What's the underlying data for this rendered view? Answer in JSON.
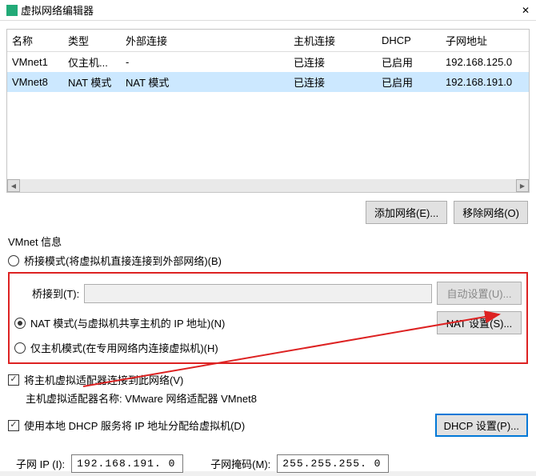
{
  "title": "虚拟网络编辑器",
  "table": {
    "headers": [
      "名称",
      "类型",
      "外部连接",
      "主机连接",
      "DHCP",
      "子网地址"
    ],
    "rows": [
      {
        "name": "VMnet1",
        "type": "仅主机...",
        "ext": "-",
        "host": "已连接",
        "dhcp": "已启用",
        "subnet": "192.168.125.0"
      },
      {
        "name": "VMnet8",
        "type": "NAT 模式",
        "ext": "NAT 模式",
        "host": "已连接",
        "dhcp": "已启用",
        "subnet": "192.168.191.0"
      }
    ]
  },
  "buttons": {
    "addNet": "添加网络(E)...",
    "removeNet": "移除网络(O)"
  },
  "groupLabel": "VMnet 信息",
  "radios": {
    "bridge": "桥接模式(将虚拟机直接连接到外部网络)(B)",
    "bridgeTo": "桥接到(T):",
    "autoSet": "自动设置(U)...",
    "nat": "NAT 模式(与虚拟机共享主机的 IP 地址)(N)",
    "natSet": "NAT 设置(S)...",
    "hostonly": "仅主机模式(在专用网络内连接虚拟机)(H)"
  },
  "checks": {
    "hostAdapter": "将主机虚拟适配器连接到此网络(V)",
    "adapterName": "主机虚拟适配器名称: VMware 网络适配器 VMnet8",
    "dhcp": "使用本地 DHCP 服务将 IP 地址分配给虚拟机(D)",
    "dhcpSet": "DHCP 设置(P)..."
  },
  "subnet": {
    "ipLabel": "子网 IP (I):",
    "ipVal": "192.168.191. 0 ",
    "maskLabel": "子网掩码(M):",
    "maskVal": "255.255.255. 0 "
  }
}
